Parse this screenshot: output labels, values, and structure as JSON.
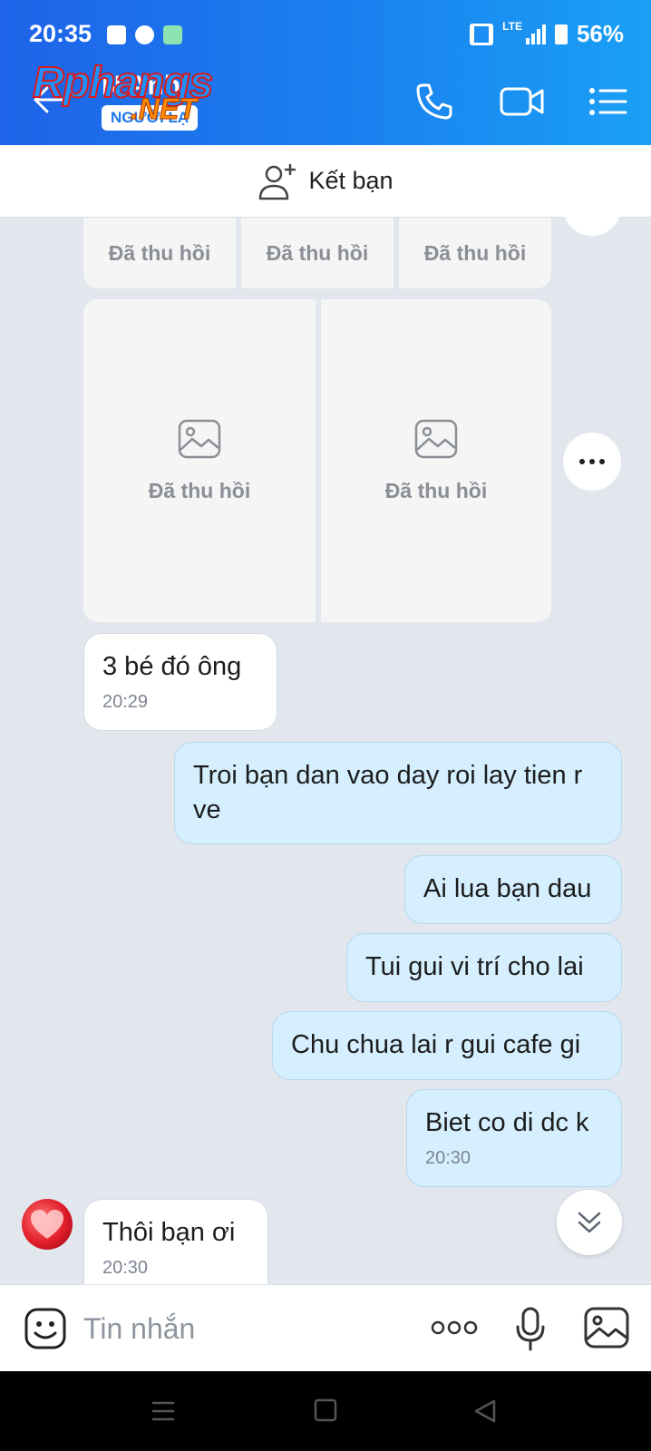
{
  "status_bar": {
    "time": "20:35",
    "lte": "LTE",
    "battery": "56%"
  },
  "header": {
    "contact_name": "N Anh",
    "stranger_badge": "NGƯỜI LẠ",
    "watermark_main": "Rphangs",
    "watermark_sub": ".NET",
    "back_icon": "arrow-left-icon",
    "call_icon": "phone-icon",
    "video_icon": "video-camera-icon",
    "menu_icon": "list-menu-icon"
  },
  "add_friend": {
    "label": "Kết bạn",
    "icon": "add-person-icon"
  },
  "recalled_label": "Đã thu hồi",
  "messages": [
    {
      "side": "in",
      "text": "3 bé đó ông",
      "time": "20:29"
    },
    {
      "side": "out",
      "text": "Troi bạn dan vao day roi lay tien r ve"
    },
    {
      "side": "out",
      "text": "Ai lua bạn dau"
    },
    {
      "side": "out",
      "text": "Tui gui vi trí cho lai"
    },
    {
      "side": "out",
      "text": "Chu chua lai r gui cafe gi"
    },
    {
      "side": "out",
      "text": "Biet co di dc k",
      "time": "20:30"
    },
    {
      "side": "in",
      "text": "Thôi bạn ơi",
      "time": "20:30"
    }
  ],
  "composer": {
    "placeholder": "Tin nhắn"
  },
  "colors": {
    "header": "#1a7ff0",
    "bubble_out": "#d5efff",
    "bubble_in": "#ffffff",
    "chat_bg": "#e2e7ee"
  }
}
